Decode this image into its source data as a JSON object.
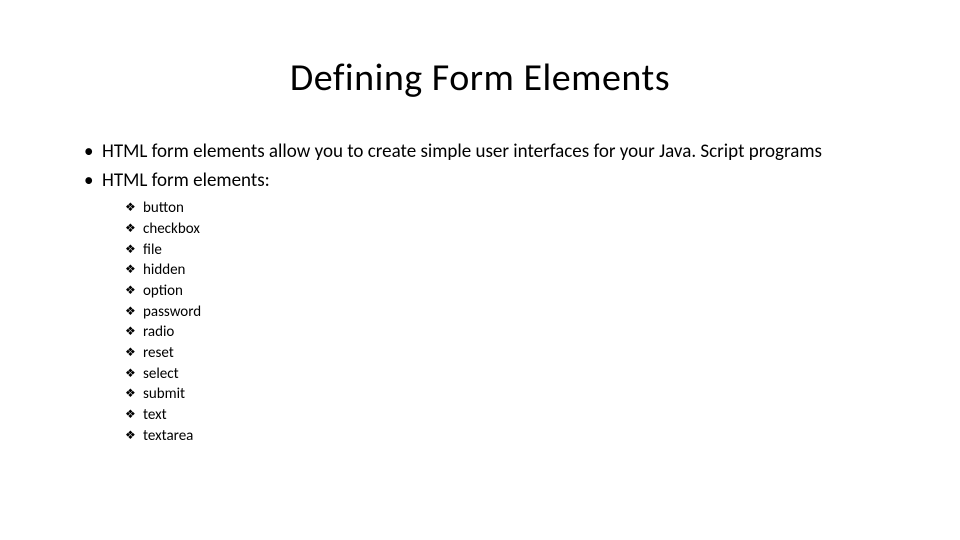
{
  "slide": {
    "title": "Defining Form Elements",
    "bullets": {
      "item0": "HTML form elements allow you to create simple user interfaces for your Java. Script programs",
      "item1": "HTML form elements:"
    },
    "form_elements": {
      "item0": "button",
      "item1": "checkbox",
      "item2": "file",
      "item3": "hidden",
      "item4": "option",
      "item5": "password",
      "item6": "radio",
      "item7": "reset",
      "item8": "select",
      "item9": "submit",
      "item10": "text",
      "item11": "textarea"
    }
  }
}
